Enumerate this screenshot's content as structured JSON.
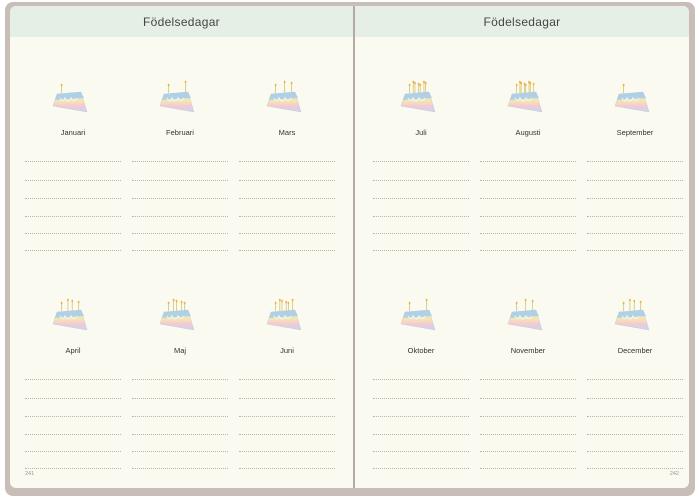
{
  "left_page": {
    "title": "Födelsedagar",
    "page_number": "241",
    "months": [
      "Januari",
      "Februari",
      "Mars",
      "April",
      "Maj",
      "Juni"
    ]
  },
  "right_page": {
    "title": "Födelsedagar",
    "page_number": "242",
    "months": [
      "Juli",
      "Augusti",
      "September",
      "Oktober",
      "November",
      "December"
    ]
  },
  "illustration": "birthday-cake-slice-icon",
  "colors": {
    "header_band": "#e6efe6",
    "paper": "#fbfaf0",
    "cover": "#c9bdb8"
  }
}
